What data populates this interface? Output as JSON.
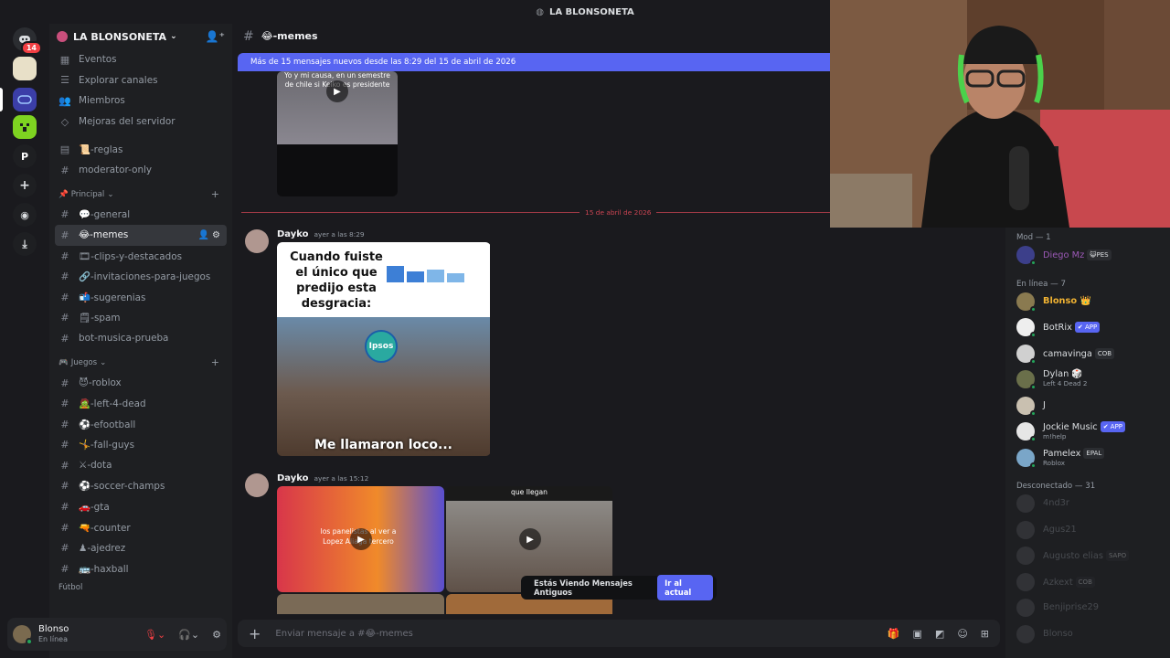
{
  "app": {
    "window_title": "LA BLONSONETA"
  },
  "servers": {
    "notification_badge": "14",
    "letter_server": "P"
  },
  "guild": {
    "name": "LA BLONSONETA"
  },
  "channels": {
    "top": [
      {
        "icon": "calendar-icon",
        "label": "Eventos"
      },
      {
        "icon": "list-icon",
        "label": "Explorar canales"
      },
      {
        "icon": "people-icon",
        "label": "Miembros"
      },
      {
        "icon": "boost-icon",
        "label": "Mejoras del servidor"
      }
    ],
    "pre": [
      {
        "glyph": "▤",
        "label": "📜-reglas"
      },
      {
        "glyph": "#",
        "label": "moderator-only"
      }
    ],
    "cat_principal": "Principal",
    "principal": [
      {
        "label": "💬-general"
      },
      {
        "label": "😂-memes",
        "active": true
      },
      {
        "label": "🎞-clips-y-destacados"
      },
      {
        "label": "🔗-invitaciones-para-juegos"
      },
      {
        "label": "📬-sugerenias"
      },
      {
        "label": "🗒-spam"
      },
      {
        "label": "bot-musica-prueba"
      }
    ],
    "cat_juegos": "Juegos",
    "juegos": [
      {
        "label": "😈-roblox"
      },
      {
        "label": "🧟-left-4-dead"
      },
      {
        "label": "⚽-efootball"
      },
      {
        "label": "🤸-fall-guys"
      },
      {
        "label": "⚔-dota"
      },
      {
        "label": "⚽-soccer-champs"
      },
      {
        "label": "🚗-gta"
      },
      {
        "label": "🔫-counter"
      },
      {
        "label": "♟-ajedrez"
      },
      {
        "label": "🚌-haxball"
      }
    ],
    "cat_futbol": "Fútbol"
  },
  "user": {
    "name": "Blonso",
    "status": "En línea"
  },
  "chat": {
    "channel_name": "😂-memes",
    "new_messages_bar": "Más de 15 mensajes nuevos desde las 8:29 del 15 de abril de 2026",
    "video1_caption": "Yo y mi causa, en un semestre de chile si Keiko es presidente",
    "date_divider": "15 de abril de 2026",
    "messages": [
      {
        "author": "Dayko",
        "time": "ayer a las 8:29",
        "meme_text": "Cuando fuiste el único que predijo esta desgracia:",
        "meme_logo": "Ipsos",
        "meme_caption": "Me llamaron loco..."
      },
      {
        "author": "Dayko",
        "time": "ayer a las 15:12",
        "video_a_caption": "los panelistas al ver a Lopez Aliaga tercero",
        "video_b_caption": "que llegan"
      }
    ],
    "old_messages_notice": "Estás Viendo Mensajes Antiguos",
    "jump_button": "Ir al actual",
    "composer_placeholder": "Enviar mensaje a #😂-memes"
  },
  "members": {
    "mod_header": "Mod — 1",
    "mods": [
      {
        "name": "Diego Mz",
        "tag": "😺PES"
      }
    ],
    "online_header": "En línea — 7",
    "online": [
      {
        "name": "Blonso 👑",
        "tag": "",
        "sub": ""
      },
      {
        "name": "BotRix",
        "tag": "✔ APP",
        "sub": ""
      },
      {
        "name": "camavinga",
        "tag": "COB",
        "sub": ""
      },
      {
        "name": "Dylan 🎲",
        "tag": "",
        "sub": "Left 4 Dead 2"
      },
      {
        "name": "J",
        "tag": "",
        "sub": ""
      },
      {
        "name": "Jockie Music",
        "tag": "✔ APP",
        "sub": "m!help"
      },
      {
        "name": "Pamelex",
        "tag": "EPAL",
        "sub": "Roblox"
      }
    ],
    "offline_header": "Desconectado — 31",
    "offline": [
      {
        "name": "4nd3r",
        "tag": ""
      },
      {
        "name": "Agus21",
        "tag": ""
      },
      {
        "name": "Augusto elias",
        "tag": "SAPO"
      },
      {
        "name": "Azkext",
        "tag": "COB"
      },
      {
        "name": "Benjiprise29",
        "tag": ""
      },
      {
        "name": "Blonso",
        "tag": ""
      }
    ]
  },
  "colors": {
    "accent": "#5865f2",
    "online": "#23a55a",
    "danger": "#f23f43",
    "mod_name": "#9b59b6",
    "owner_name": "#f0b232"
  }
}
